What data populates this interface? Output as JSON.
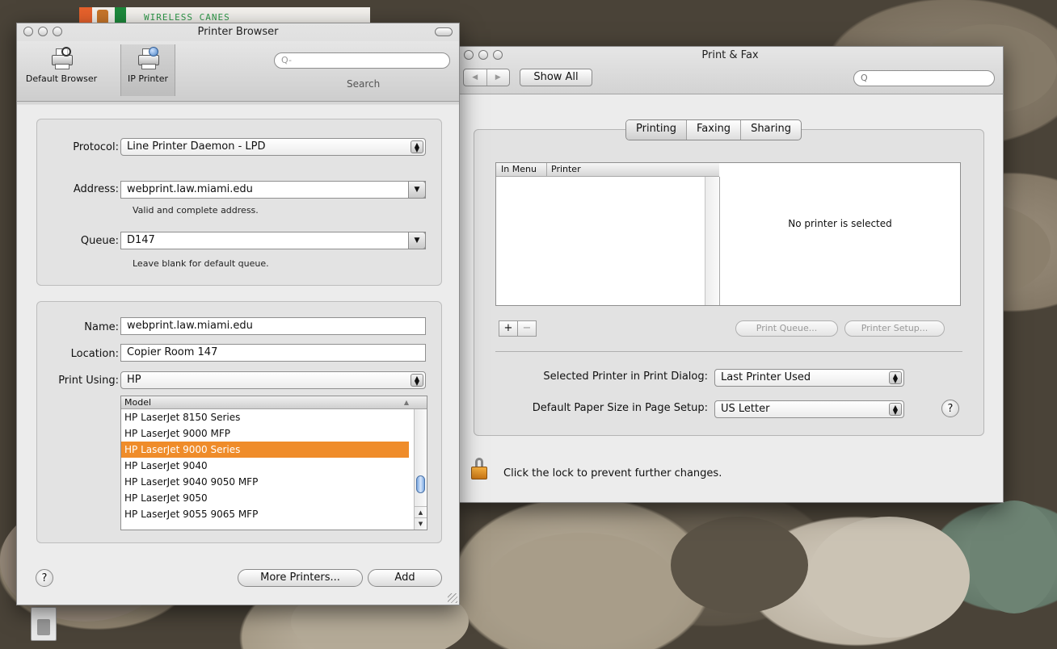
{
  "desktop": {
    "banner_text": "WIRELESS CANES"
  },
  "printer_browser": {
    "title": "Printer Browser",
    "toolbar": {
      "default_browser_label": "Default Browser",
      "ip_printer_label": "IP Printer",
      "search_placeholder": "Q-",
      "search_label": "Search"
    },
    "protocol": {
      "label": "Protocol:",
      "value": "Line Printer Daemon - LPD"
    },
    "address": {
      "label": "Address:",
      "value": "webprint.law.miami.edu",
      "hint": "Valid and complete address."
    },
    "queue": {
      "label": "Queue:",
      "value": "D147",
      "hint": "Leave blank for default queue."
    },
    "name": {
      "label": "Name:",
      "value": "webprint.law.miami.edu"
    },
    "location": {
      "label": "Location:",
      "value": "Copier Room 147"
    },
    "print_using": {
      "label": "Print Using:",
      "value": "HP"
    },
    "model_list": {
      "header": "Model",
      "items": [
        "HP LaserJet 8150 Series",
        "HP LaserJet 9000 MFP",
        "HP LaserJet 9000 Series",
        "HP LaserJet 9040",
        "HP LaserJet 9040 9050 MFP",
        "HP LaserJet 9050",
        "HP LaserJet 9055 9065 MFP"
      ],
      "selected_index": 2,
      "selection_color": "#ef8c2a"
    },
    "help_label": "?",
    "more_printers_label": "More Printers...",
    "add_label": "Add"
  },
  "print_fax": {
    "title": "Print & Fax",
    "show_all_label": "Show All",
    "nav_back": "◀",
    "nav_forward": "▶",
    "search_placeholder": "Q",
    "tabs": [
      "Printing",
      "Faxing",
      "Sharing"
    ],
    "active_tab": "Printing",
    "list_headers": {
      "in_menu": "In Menu",
      "printer": "Printer"
    },
    "no_printer_text": "No printer is selected",
    "add_symbol": "+",
    "remove_symbol": "−",
    "print_queue_label": "Print Queue...",
    "printer_setup_label": "Printer Setup...",
    "selected_printer": {
      "label": "Selected Printer in Print Dialog:",
      "value": "Last Printer Used"
    },
    "paper_size": {
      "label": "Default Paper Size in Page Setup:",
      "value": "US Letter"
    },
    "help_label": "?",
    "lock_text": "Click the lock to prevent further changes."
  }
}
